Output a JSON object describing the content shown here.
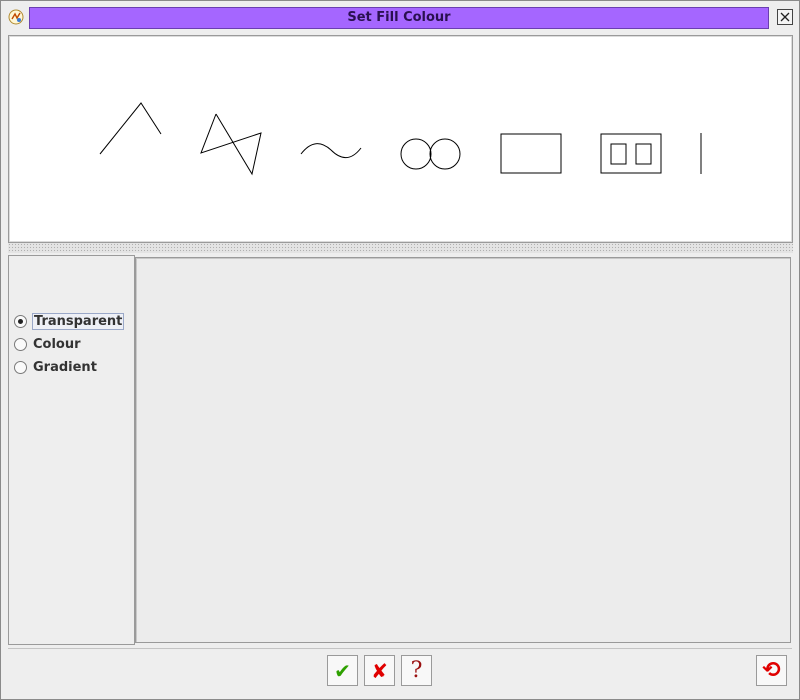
{
  "window": {
    "title": "Set Fill Colour"
  },
  "icons": {
    "app": "app-logo-icon",
    "close": "close-icon",
    "ok": "checkmark-icon",
    "cancel": "cross-icon",
    "help": "question-icon",
    "reset": "reset-icon"
  },
  "colors": {
    "title_bar": "#a566ff",
    "ok_icon": "#2ea000",
    "cancel_icon": "#e00000",
    "help_icon": "#9a1010",
    "reset_icon": "#e00000"
  },
  "preview": {
    "shapes": [
      "polyline",
      "zigzag",
      "wave",
      "double-circle",
      "rectangle",
      "double-box",
      "vertical-line"
    ]
  },
  "fill_options": {
    "selected": "Transparent",
    "options": [
      "Transparent",
      "Colour",
      "Gradient"
    ]
  },
  "buttons": {
    "ok_glyph": "✔",
    "cancel_glyph": "✘",
    "help_glyph": "?",
    "reset_glyph": "⟲"
  }
}
